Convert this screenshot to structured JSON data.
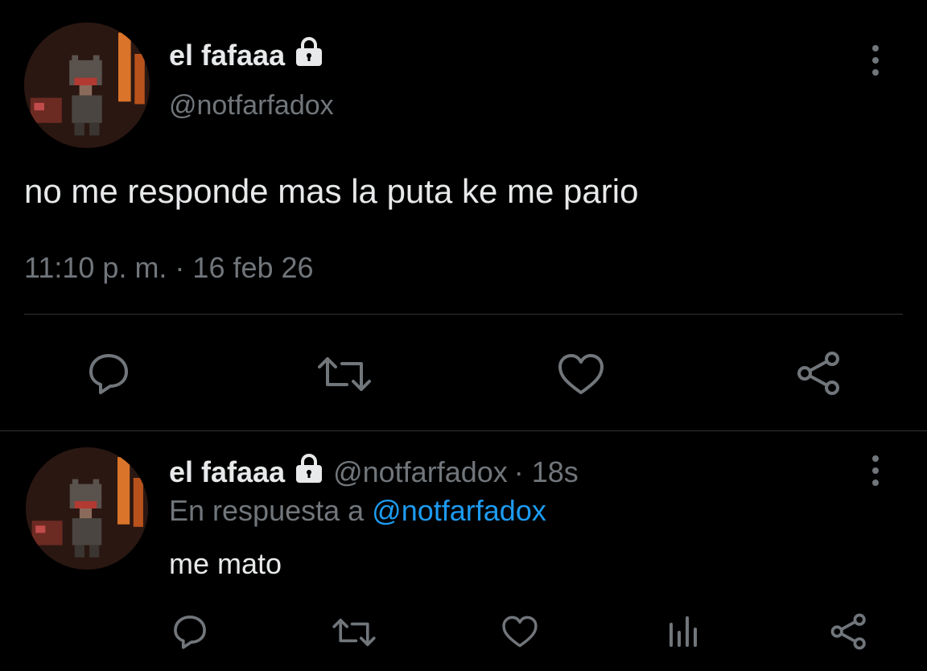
{
  "main_tweet": {
    "display_name": "el fafaaa",
    "handle": "@notfarfadox",
    "text": "no me responde mas la puta ke me pario",
    "timestamp": "11:10 p. m. · 16 feb 26",
    "icons": [
      "reply-icon",
      "retweet-icon",
      "like-icon",
      "share-icon"
    ]
  },
  "reply_tweet": {
    "display_name": "el fafaaa",
    "handle": "@notfarfadox",
    "time_ago": "· 18s",
    "reply_prefix": "En respuesta a",
    "reply_to": "@notfarfadox",
    "text": "me mato",
    "icons": [
      "reply-icon",
      "retweet-icon",
      "like-icon",
      "analytics-icon",
      "share-icon"
    ]
  },
  "colors": {
    "background": "#000000",
    "text": "#e7e9ea",
    "muted": "#71767b",
    "link": "#1d9bf0",
    "divider": "#2f3336"
  }
}
